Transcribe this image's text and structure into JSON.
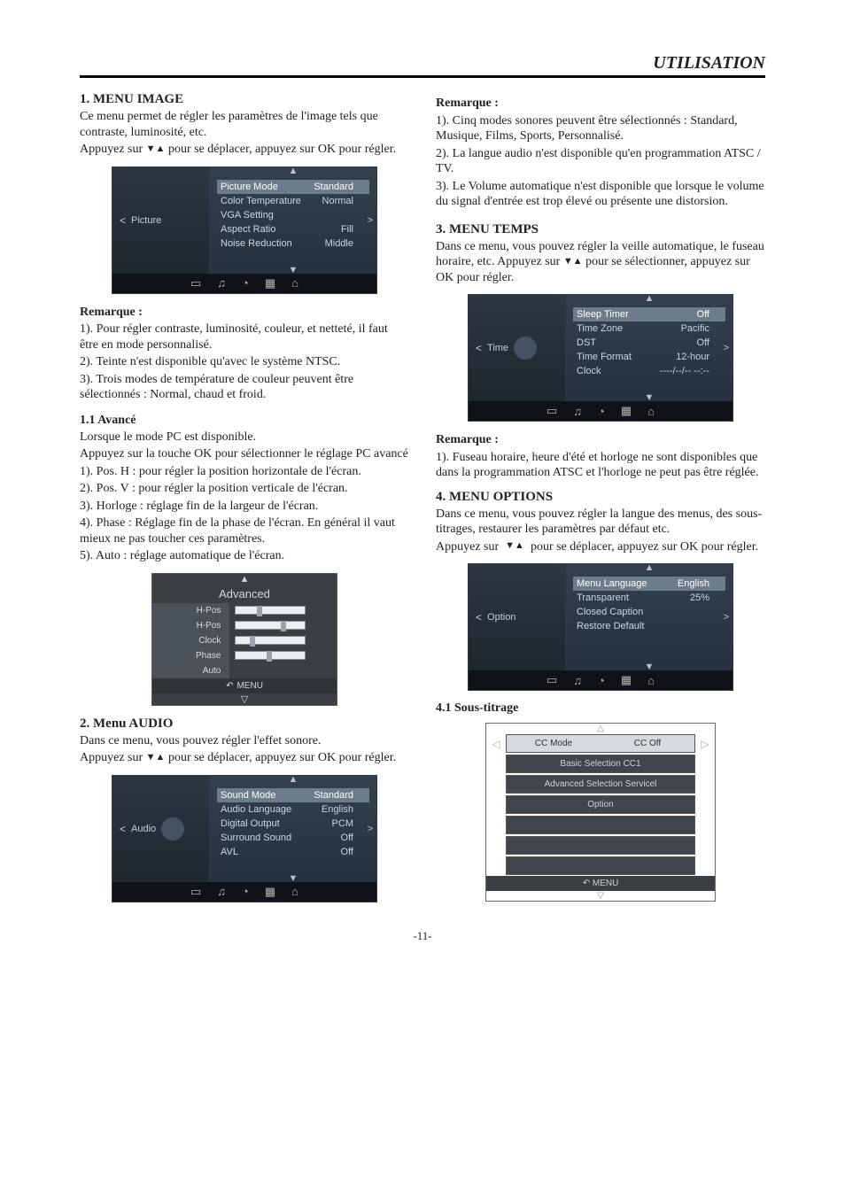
{
  "page": {
    "header": "UTILISATION",
    "number": "-11-"
  },
  "nav_hint_prefix": "Appuyez sur",
  "nav_hint_suffix": "pour se déplacer, appuyez sur OK pour régler.",
  "left": {
    "s1": {
      "title": "1. MENU IMAGE",
      "intro": "Ce menu permet de régler les paramètres de l'image tels que contraste, luminosité, etc.",
      "nav_tail": "pour se déplacer, appuyez sur OK pour régler.",
      "osd": {
        "category": "Picture",
        "rows": [
          {
            "label": "Picture Mode",
            "value": "Standard",
            "selected": true
          },
          {
            "label": "Color Temperature",
            "value": "Normal"
          },
          {
            "label": "VGA Setting",
            "value": ""
          },
          {
            "label": "Aspect Ratio",
            "value": "Fill"
          },
          {
            "label": "Noise Reduction",
            "value": "Middle"
          }
        ]
      },
      "note_label": "Remarque :",
      "notes": [
        "1). Pour régler contraste, luminosité, couleur, et netteté, il faut être en mode personnalisé.",
        "2). Teinte n'est disponible qu'avec le système NTSC.",
        "3). Trois modes de température de couleur peuvent être sélectionnés : Normal, chaud et froid."
      ],
      "adv_title": "1.1 Avancé",
      "adv_intro1": "Lorsque le mode PC est disponible.",
      "adv_intro2": "Appuyez sur la touche OK pour sélectionner le réglage PC avancé",
      "adv_items": [
        "1). Pos. H : pour régler la position horizontale de l'écran.",
        "2). Pos. V : pour régler la position verticale de l'écran.",
        "3). Horloge : réglage fin de la largeur de l'écran.",
        "4). Phase : Réglage fin de la phase de l'écran. En général il vaut mieux ne pas toucher ces paramètres.",
        "5). Auto : réglage automatique de l'écran."
      ],
      "adv_osd": {
        "title": "Advanced",
        "rows": [
          "H-Pos",
          "H-Pos",
          "Clock",
          "Phase",
          "Auto"
        ],
        "menu": "MENU"
      }
    },
    "s2": {
      "title": "2. Menu AUDIO",
      "intro": "Dans ce menu, vous pouvez régler l'effet sonore.",
      "osd": {
        "category": "Audio",
        "rows": [
          {
            "label": "Sound Mode",
            "value": "Standard",
            "selected": true
          },
          {
            "label": "Audio Language",
            "value": "English"
          },
          {
            "label": "Digital Output",
            "value": "PCM"
          },
          {
            "label": "Surround Sound",
            "value": "Off"
          },
          {
            "label": "AVL",
            "value": "Off"
          }
        ]
      }
    }
  },
  "right": {
    "audio_note_label": "Remarque :",
    "audio_notes": [
      "1). Cinq modes sonores peuvent être sélectionnés : Standard, Musique, Films, Sports, Personnalisé.",
      "2). La langue audio n'est disponible qu'en programmation ATSC / TV.",
      "3). Le Volume automatique n'est disponible que lorsque le volume du signal d'entrée est trop élevé ou présente une distorsion."
    ],
    "s3": {
      "title": "3. MENU TEMPS",
      "intro_a": "Dans ce menu, vous pouvez régler la veille automatique, le fuseau horaire, etc. Appuyez sur",
      "intro_b": "pour se sélectionner, appuyez sur OK pour régler.",
      "osd": {
        "category": "Time",
        "rows": [
          {
            "label": "Sleep Timer",
            "value": "Off",
            "selected": true
          },
          {
            "label": "Time Zone",
            "value": "Pacific"
          },
          {
            "label": "DST",
            "value": "Off"
          },
          {
            "label": "Time Format",
            "value": "12-hour"
          },
          {
            "label": "Clock",
            "value": "----/--/--  --:--"
          }
        ]
      },
      "note_label": "Remarque :",
      "notes": [
        "1). Fuseau horaire, heure d'été et horloge ne sont disponibles que dans la programmation ATSC et l'horloge ne peut pas être réglée."
      ]
    },
    "s4": {
      "title": "4. MENU OPTIONS",
      "intro": "Dans ce menu, vous pouvez régler la langue des menus, des sous-titrages, restaurer les paramètres par défaut etc.",
      "osd": {
        "category": "Option",
        "rows": [
          {
            "label": "Menu Language",
            "value": "English",
            "selected": true
          },
          {
            "label": "Transparent",
            "value": "25%"
          },
          {
            "label": "Closed Caption",
            "value": ""
          },
          {
            "label": "Restore Default",
            "value": ""
          }
        ]
      },
      "cc_title": "4.1 Sous-titrage",
      "cc_osd": {
        "row1_left": "CC Mode",
        "row1_right": "CC Off",
        "row2": "Basic Selection CC1",
        "row3": "Advanced Selection Servicel",
        "row4": "Option",
        "menu": "MENU"
      }
    }
  }
}
